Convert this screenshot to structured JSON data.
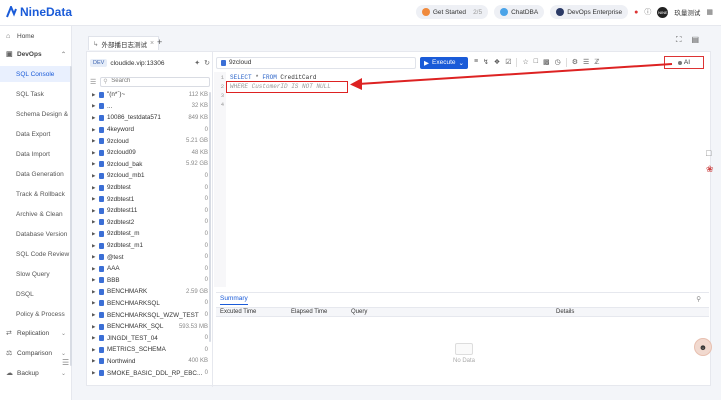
{
  "brand": {
    "name": "NineData"
  },
  "topbar": {
    "get_started": "Get Started",
    "get_started_progress": "2/5",
    "chatdba": "ChatDBA",
    "devops": "DevOps Enterprise",
    "user": "玖量测试",
    "avatar_text": "NINE"
  },
  "nav": {
    "home": "Home",
    "devops": "DevOps",
    "items": [
      "SQL Console",
      "SQL Task",
      "Schema Design &",
      "Data Export",
      "Data Import",
      "Data Generation",
      "Track & Rollback",
      "Archive & Clean",
      "Database Version",
      "SQL Code Review",
      "Slow Query",
      "DSQL",
      "Policy & Process"
    ],
    "replication": "Replication",
    "comparison": "Comparison",
    "backup": "Backup"
  },
  "tab": {
    "label": "外部播日志测试"
  },
  "connection": {
    "env": "DEV",
    "name": "cloudide.vip:13306"
  },
  "search": {
    "placeholder": "Search"
  },
  "databases": [
    {
      "name": "\"(n*`)~",
      "size": "112 KB"
    },
    {
      "name": "...",
      "size": "32 KB"
    },
    {
      "name": "10086_testdata571",
      "size": "849 KB"
    },
    {
      "name": "4keyword",
      "size": "0"
    },
    {
      "name": "9zcloud",
      "size": "5.21 GB"
    },
    {
      "name": "9zcloud09",
      "size": "48 KB"
    },
    {
      "name": "9zcloud_bak",
      "size": "5.92 GB"
    },
    {
      "name": "9zcloud_mb1",
      "size": "0"
    },
    {
      "name": "9zdbtest",
      "size": "0"
    },
    {
      "name": "9zdbtest1",
      "size": "0"
    },
    {
      "name": "9zdbtest11",
      "size": "0"
    },
    {
      "name": "9zdbtest2",
      "size": "0"
    },
    {
      "name": "9zdbtest_m",
      "size": "0"
    },
    {
      "name": "9zdbtest_m1",
      "size": "0"
    },
    {
      "name": "@test",
      "size": "0"
    },
    {
      "name": "AAA",
      "size": "0"
    },
    {
      "name": "BBB",
      "size": "0"
    },
    {
      "name": "BENCHMARK",
      "size": "2.59 GB"
    },
    {
      "name": "BENCHMARKSQL",
      "size": "0"
    },
    {
      "name": "BENCHMARKSQL_WZW_TEST",
      "size": "0"
    },
    {
      "name": "BENCHMARK_SQL",
      "size": "593.53 MB"
    },
    {
      "name": "JINGDI_TEST_04",
      "size": "0"
    },
    {
      "name": "METRICS_SCHEMA",
      "size": "0"
    },
    {
      "name": "Northwind",
      "size": "400 KB"
    },
    {
      "name": "SMOKE_BASIC_DDL_RP_EBC...",
      "size": "0"
    }
  ],
  "editor": {
    "database": "9zcloud",
    "execute": "Execute",
    "ai": "AI",
    "line_numbers": [
      "1",
      "2",
      "3",
      "4"
    ],
    "line1_kw1": "SELECT",
    "line1_mid": " * ",
    "line1_kw2": "FROM",
    "line1_rest": " CreditCard",
    "line2": "WHERE CustomerID IS NOT NULL"
  },
  "results": {
    "tab": "Summary",
    "columns": [
      "Excuted Time",
      "Elapsed Time",
      "Query",
      "Details"
    ],
    "empty": "No Data"
  },
  "colors": {
    "accent": "#1a5bd8",
    "highlight": "#dd2222"
  }
}
